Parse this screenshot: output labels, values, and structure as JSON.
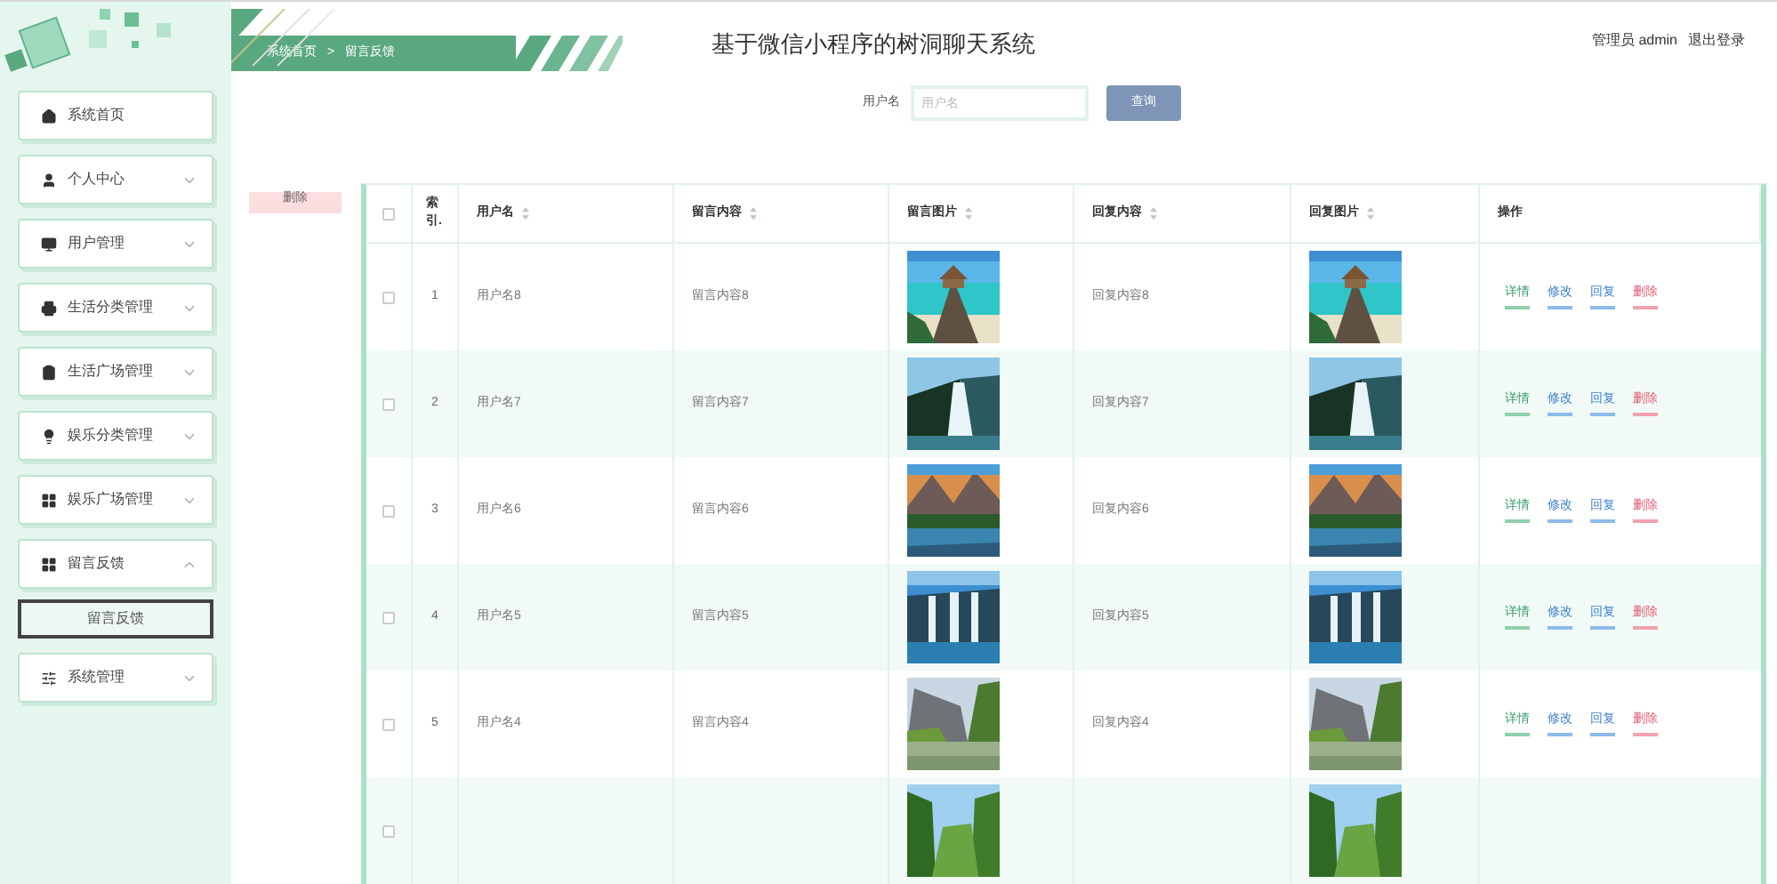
{
  "header": {
    "title": "基于微信小程序的树洞聊天系统",
    "user": "管理员 admin",
    "logout": "退出登录"
  },
  "breadcrumb": [
    "系统首页",
    "留言反馈"
  ],
  "breadcrumb_separator": ">",
  "sidebar": {
    "items": [
      {
        "label": "系统首页",
        "has_children": false
      },
      {
        "label": "个人中心",
        "has_children": true,
        "expanded": false
      },
      {
        "label": "用户管理",
        "has_children": true,
        "expanded": false
      },
      {
        "label": "生活分类管理",
        "has_children": true,
        "expanded": false
      },
      {
        "label": "生活广场管理",
        "has_children": true,
        "expanded": false
      },
      {
        "label": "娱乐分类管理",
        "has_children": true,
        "expanded": false
      },
      {
        "label": "娱乐广场管理",
        "has_children": true,
        "expanded": false
      },
      {
        "label": "留言反馈",
        "has_children": true,
        "expanded": true,
        "children": [
          {
            "label": "留言反馈",
            "selected": true
          }
        ]
      },
      {
        "label": "系统管理",
        "has_children": true,
        "expanded": false
      }
    ]
  },
  "search": {
    "label": "用户名",
    "placeholder": "用户名",
    "button": "查询"
  },
  "delete_button": "删除",
  "table": {
    "select_all_checked": false,
    "columns": [
      {
        "label": "索引.",
        "sortable": false
      },
      {
        "label": "用户名",
        "sortable": true
      },
      {
        "label": "留言内容",
        "sortable": true
      },
      {
        "label": "留言图片",
        "sortable": true
      },
      {
        "label": "回复内容",
        "sortable": true
      },
      {
        "label": "回复图片",
        "sortable": true
      },
      {
        "label": "操作",
        "sortable": false
      }
    ],
    "rows": [
      {
        "index": "1",
        "username": "用户名8",
        "message": "留言内容8",
        "reply": "回复内容8",
        "checked": false,
        "actions": [
          {
            "label": "详情",
            "kind": "detail"
          },
          {
            "label": "修改",
            "kind": "edit"
          },
          {
            "label": "回复",
            "kind": "reply"
          },
          {
            "label": "删除",
            "kind": "delete"
          }
        ]
      },
      {
        "index": "2",
        "username": "用户名7",
        "message": "留言内容7",
        "reply": "回复内容7",
        "checked": false,
        "actions": [
          {
            "label": "详情",
            "kind": "detail"
          },
          {
            "label": "修改",
            "kind": "edit"
          },
          {
            "label": "回复",
            "kind": "reply"
          },
          {
            "label": "删除",
            "kind": "delete"
          }
        ]
      },
      {
        "index": "3",
        "username": "用户名6",
        "message": "留言内容6",
        "reply": "回复内容6",
        "checked": false,
        "actions": [
          {
            "label": "详情",
            "kind": "detail"
          },
          {
            "label": "修改",
            "kind": "edit"
          },
          {
            "label": "回复",
            "kind": "reply"
          },
          {
            "label": "删除",
            "kind": "delete"
          }
        ]
      },
      {
        "index": "4",
        "username": "用户名5",
        "message": "留言内容5",
        "reply": "回复内容5",
        "checked": false,
        "actions": [
          {
            "label": "详情",
            "kind": "detail"
          },
          {
            "label": "修改",
            "kind": "edit"
          },
          {
            "label": "回复",
            "kind": "reply"
          },
          {
            "label": "删除",
            "kind": "delete"
          }
        ]
      },
      {
        "index": "5",
        "username": "用户名4",
        "message": "留言内容4",
        "reply": "回复内容4",
        "checked": false,
        "actions": [
          {
            "label": "详情",
            "kind": "detail"
          },
          {
            "label": "修改",
            "kind": "edit"
          },
          {
            "label": "回复",
            "kind": "reply"
          },
          {
            "label": "删除",
            "kind": "delete"
          }
        ]
      },
      {
        "checked": false
      }
    ]
  }
}
